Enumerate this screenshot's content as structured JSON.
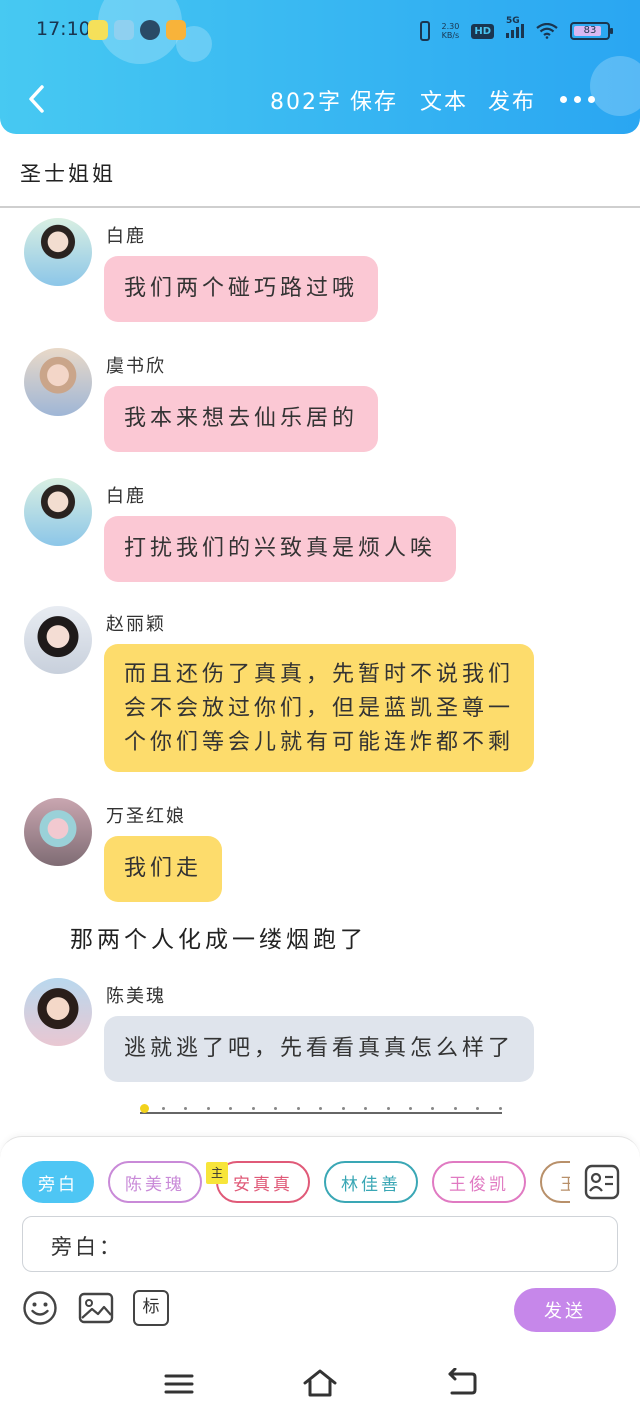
{
  "status_bar": {
    "time": "17:10",
    "net_speed_top": "2.30",
    "net_speed_unit": "KB/s",
    "hd": "HD",
    "network": "5G",
    "battery": "83",
    "battery_level": 0.83
  },
  "nav": {
    "word_count": "802字",
    "save": "保存",
    "text": "文本",
    "publish": "发布"
  },
  "story_title": "圣士姐姐",
  "messages": [
    {
      "name": "白鹿",
      "text": "我们两个碰巧路过哦",
      "color": "#fbc8d4"
    },
    {
      "name": "虞书欣",
      "text": "我本来想去仙乐居的",
      "color": "#fbc8d4"
    },
    {
      "name": "白鹿",
      "text": "打扰我们的兴致真是烦人唉",
      "color": "#fbc8d4"
    },
    {
      "name": "赵丽颖",
      "lines": [
        "而且还伤了真真，先暂时不说我们",
        "会不会放过你们，但是蓝凯圣尊一",
        "个你们等会儿就有可能连炸都不剩"
      ],
      "color": "#fddc6c"
    },
    {
      "name": "万圣红娘",
      "text": "我们走",
      "color": "#fddc6c"
    },
    {
      "name": "陈美瑰",
      "text": "逃就逃了吧，先看看真真怎么样了",
      "color": "#dfe4ec"
    }
  ],
  "narration": "那两个人化成一缕烟跑了",
  "characters": [
    {
      "label": "旁白",
      "color": "#4ec6f4"
    },
    {
      "label": "陈美瑰",
      "color": "#c98ad8"
    },
    {
      "label": "安真真",
      "color": "#e05a78"
    },
    {
      "label": "林佳善",
      "color": "#3aa7b5"
    },
    {
      "label": "王俊凯",
      "color": "#e07ac2"
    },
    {
      "label": "王",
      "color": "#b8906a"
    }
  ],
  "main_badge": "主",
  "input": {
    "prefix": "旁白："
  },
  "toolbar": {
    "tag_label": "标",
    "send_label": "发送"
  },
  "colors": {
    "header_start": "#47c9f2",
    "header_end": "#2aa6f2",
    "send": "#c687ea"
  }
}
